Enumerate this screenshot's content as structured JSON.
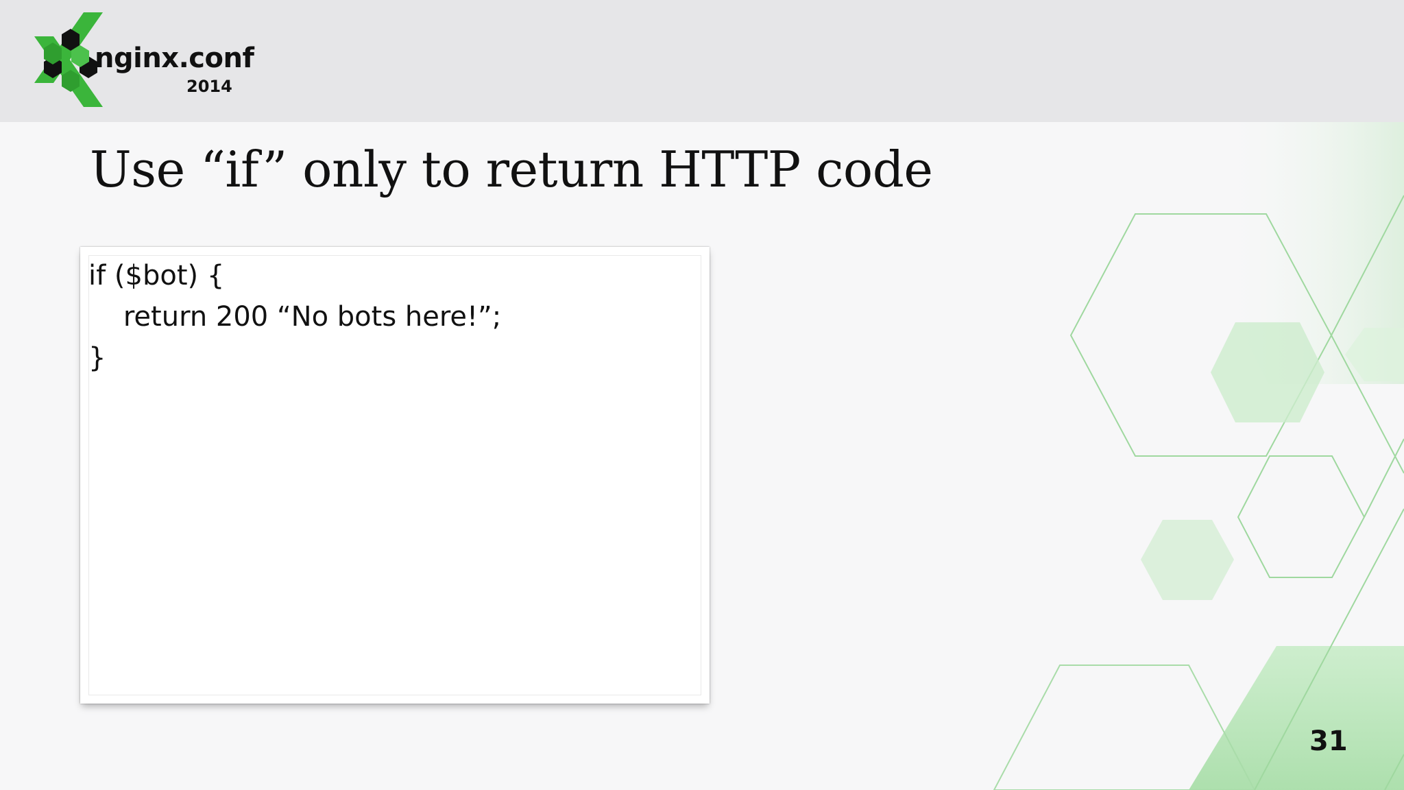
{
  "logo": {
    "name": "nginx.conf",
    "year": "2014",
    "colors": {
      "green": "#3bb53b",
      "dark": "#111111"
    }
  },
  "slide": {
    "title": "Use “if” only to return HTTP code",
    "code_lines": [
      "if ($bot) {",
      "    return 200 “No bots here!”;",
      "}"
    ],
    "page_number": "31"
  },
  "theme": {
    "background": "#f7f7f8",
    "header_band": "#e6e6e8",
    "accent_green": "#7fd07f"
  }
}
